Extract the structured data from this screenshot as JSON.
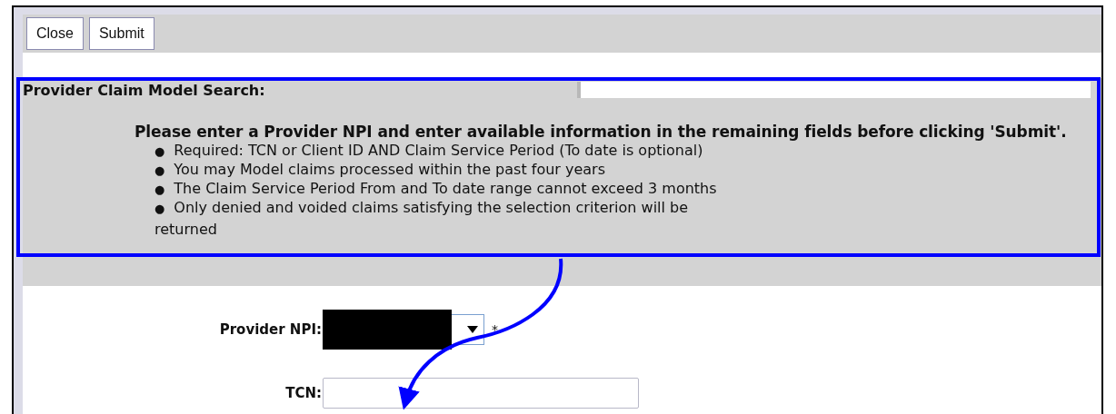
{
  "toolbar": {
    "buttons": [
      "Close",
      "Submit"
    ]
  },
  "search_panel": {
    "title": "Provider Claim Model Search:",
    "instruction": "Please enter a Provider NPI and enter available information in the remaining fields before clicking 'Submit'.",
    "bullets": [
      {
        "marker": "●",
        "text": "Required: TCN or Client ID AND Claim Service Period (To date is optional)"
      },
      {
        "marker": "●",
        "text": "You may Model claims processed within the past four years"
      },
      {
        "marker": "●",
        "text": "The Claim Service Period From and To date range cannot exceed 3 months"
      },
      {
        "marker": "●",
        "text": "Only denied and voided claims satisfying the selection criterion will be",
        "continuation": "returned"
      }
    ]
  },
  "form": {
    "fields": [
      {
        "kind": "select",
        "label": "Provider NPI:",
        "required_mark": "*",
        "redacted": true
      },
      {
        "kind": "text",
        "label": "TCN:"
      }
    ]
  }
}
